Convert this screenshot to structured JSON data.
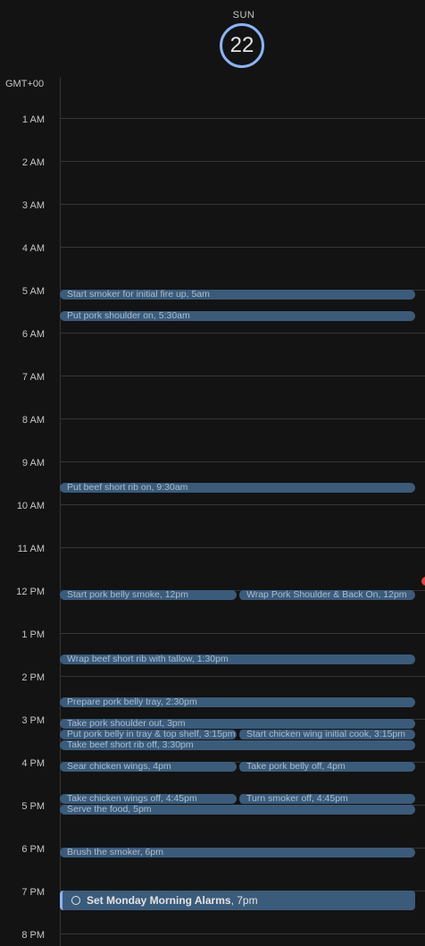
{
  "header": {
    "day_of_week": "SUN",
    "day_number": "22",
    "timezone": "GMT+00"
  },
  "hours": [
    "1 AM",
    "2 AM",
    "3 AM",
    "4 AM",
    "5 AM",
    "6 AM",
    "7 AM",
    "8 AM",
    "9 AM",
    "10 AM",
    "11 AM",
    "12 PM",
    "1 PM",
    "2 PM",
    "3 PM",
    "4 PM",
    "5 PM",
    "6 PM",
    "7 PM",
    "8 PM"
  ],
  "events": [
    {
      "title": "Start smoker for initial fire up, 5am"
    },
    {
      "title": "Put pork shoulder on, 5:30am"
    },
    {
      "title": "Put beef short rib on, 9:30am"
    },
    {
      "title": "Start pork belly smoke, 12pm"
    },
    {
      "title": "Wrap Pork Shoulder & Back On, 12pm"
    },
    {
      "title": "Wrap beef short rib with tallow, 1:30pm"
    },
    {
      "title": "Prepare pork belly tray, 2:30pm"
    },
    {
      "title": "Take pork shoulder out, 3pm"
    },
    {
      "title": "Put pork belly in tray & top shelf, 3:15pm"
    },
    {
      "title": "Start chicken wing initial cook, 3:15pm"
    },
    {
      "title": "Take beef short rib off, 3:30pm"
    },
    {
      "title": "Sear chicken wings, 4pm"
    },
    {
      "title": "Take pork belly off, 4pm"
    },
    {
      "title": "Take chicken wings off, 4:45pm"
    },
    {
      "title": "Turn smoker off, 4:45pm"
    },
    {
      "title": "Serve the food, 5pm"
    },
    {
      "title": "Brush the smoker, 6pm"
    }
  ],
  "task": {
    "title": "Set Monday Morning Alarms",
    "time": ", 7pm"
  },
  "colors": {
    "event_bg": "#3b5b7b",
    "today_ring": "#8ab4f8",
    "now_indicator": "#ea4335",
    "background": "#131313"
  }
}
